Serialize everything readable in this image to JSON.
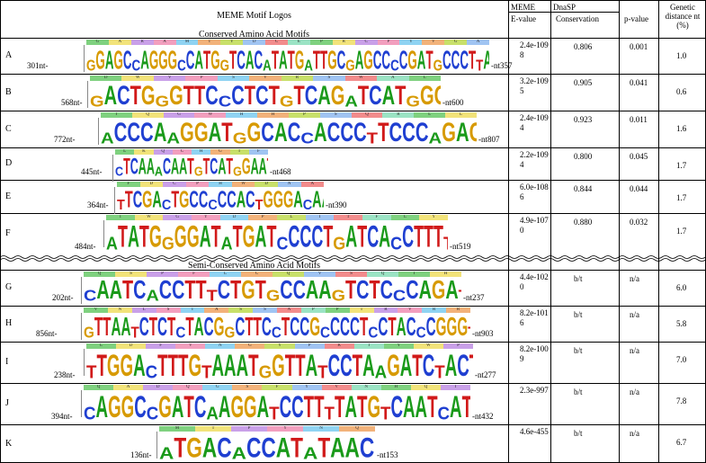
{
  "header": {
    "logos_title": "MEME Motif Logos",
    "conserved_title": "Conserved Amino Acid Motifs",
    "semi_title": "Semi-Conserved Amino Acid Motifs",
    "meme": "MEME",
    "evalue": "E-value",
    "dnasp": "DnaSP",
    "conservation": "Conservation",
    "pvalue": "p-value",
    "genetic": "Genetic distance nt  (%)"
  },
  "rows": [
    {
      "id": "A",
      "start": "301nt-",
      "end": "-nt357",
      "seq": "GGAGCCAGGGCCATGGTCACATATGATTGCGAGCCCCGATGCCCTTATGTGGGGGCA",
      "aa": "G A R A M T Y D C E P R C P Y V G A",
      "evalue": "2.4e-1098",
      "conservation": "0.806",
      "pvalue": "0.001",
      "distance": "1.0"
    },
    {
      "id": "B",
      "start": "568nt-",
      "end": "-nt600",
      "seq": "GACTGGGTTCCCTCTGTCAGATCATGGGCCCTG",
      "aa": "D W V P S V R S W A L",
      "evalue": "3.2e-1095",
      "conservation": "0.905",
      "pvalue": "0.041",
      "distance": "0.6"
    },
    {
      "id": "C",
      "start": "772nt-",
      "end": "-nt807",
      "seq": "ACCCAAGGATGGCACCACCCTTCCCAGAGGTTGTT",
      "aa": "T Q G W H H P S Q R L L",
      "evalue": "2.4e-1094",
      "conservation": "0.923",
      "pvalue": "0.011",
      "distance": "1.6"
    },
    {
      "id": "D",
      "start": "445nt-",
      "end": "-nt468",
      "seq": "CTCAAACAATGTCATGGAATTTC",
      "aa": "L K Q C H G I F",
      "evalue": "2.2e-1094",
      "conservation": "0.800",
      "pvalue": "0.045",
      "distance": "1.7"
    },
    {
      "id": "E",
      "start": "364nt-",
      "end": "-nt390",
      "seq": "TTCGACTGCCCCCACTGGGACAATGCC",
      "aa": "F D C P H W D N A",
      "evalue": "6.0e-1086",
      "conservation": "0.844",
      "pvalue": "0.044",
      "distance": "1.7"
    },
    {
      "id": "F",
      "start": "484nt-",
      "end": "-nt519",
      "seq": "ATATGGGGATATGATCCCCTGATCACCTTTTCTTTA",
      "aa": "I W G Y D P L I T F L Y",
      "evalue": "4.9e-1070",
      "conservation": "0.880",
      "pvalue": "0.032",
      "distance": "1.7"
    },
    {
      "id": "G",
      "start": "202nt-",
      "end": "-nt237",
      "seq": "CAATCACCTTTCTGTGCCAAGTCTCCCAGATACACC",
      "aa": "Q S P F L C Q V S Q I H",
      "evalue": "4.4e-1020",
      "conservation": "b/t",
      "pvalue": "n/a",
      "distance": "6.0"
    },
    {
      "id": "H",
      "start": "856nt-",
      "end": "-nt903",
      "seq": "GTTAATCTCTCTACGGCTTCCTCCGCCCCTCCTACCCGGGTCAGACGT",
      "aa": "V N L S T A S S A P P T R V R R",
      "evalue": "8.2e-1016",
      "conservation": "b/t",
      "pvalue": "n/a",
      "distance": "5.8"
    },
    {
      "id": "I",
      "start": "238nt-",
      "end": "-nt277",
      "seq": "TTGGACTTTGTAAATGGTTATCCTAAGATCTACTGGCCC",
      "aa": "L D F V N G Y P K I Y W P",
      "evalue": "8.2e-1009",
      "conservation": "b/t",
      "pvalue": "n/a",
      "distance": "7.0"
    },
    {
      "id": "J",
      "start": "394nt-",
      "end": "-nt432",
      "seq": "CAGGCCGATCAAGGATCCTTTTATGTCAATCATCAGATT",
      "aa": "Q A D Q G S F Y V N H Q I",
      "evalue": "2.3e-997",
      "conservation": "b/t",
      "pvalue": "n/a",
      "distance": "7.8"
    },
    {
      "id": "K",
      "start": "136nt-",
      "end": "-nt153",
      "seq": "ATGACACCATATAACCAA",
      "aa": "M T P Y N Q",
      "evalue": "4.6e-455",
      "conservation": "b/t",
      "pvalue": "n/a",
      "distance": "6.7"
    }
  ],
  "colors": {
    "A": "#1a9a1a",
    "C": "#1f3fd1",
    "G": "#d79a00",
    "T": "#d11a1a"
  }
}
